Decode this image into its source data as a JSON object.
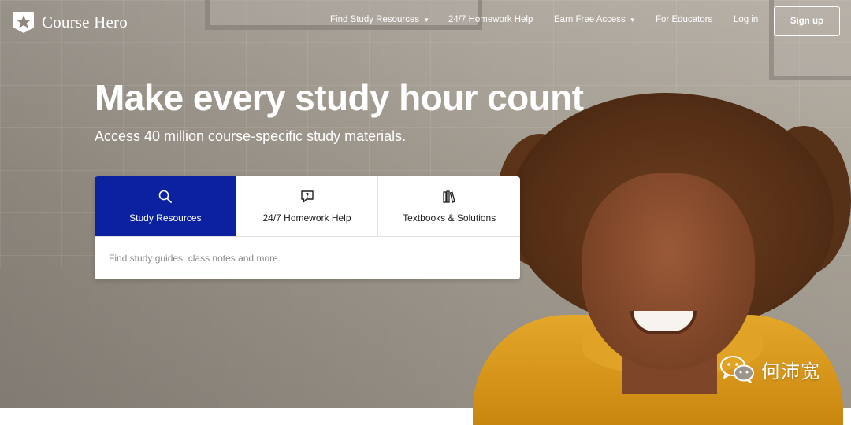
{
  "brand": {
    "name": "Course Hero"
  },
  "nav": {
    "items": [
      {
        "label": "Find Study Resources",
        "dropdown": true
      },
      {
        "label": "24/7 Homework Help",
        "dropdown": false
      },
      {
        "label": "Earn Free Access",
        "dropdown": true
      },
      {
        "label": "For Educators",
        "dropdown": false
      },
      {
        "label": "Log in",
        "dropdown": false
      }
    ],
    "signup_label": "Sign up"
  },
  "hero": {
    "headline": "Make every study hour count",
    "subheadline": "Access 40 million course-specific study materials."
  },
  "search": {
    "tabs": [
      {
        "label": "Study Resources",
        "icon": "search-icon",
        "active": true
      },
      {
        "label": "24/7 Homework Help",
        "icon": "question-bubble-icon",
        "active": false
      },
      {
        "label": "Textbooks & Solutions",
        "icon": "books-icon",
        "active": false
      }
    ],
    "placeholder": "Find study guides, class notes and more."
  },
  "watermark": {
    "text": "何沛宽"
  },
  "colors": {
    "accent": "#0c21a0",
    "text_on_dark": "#ffffff"
  }
}
